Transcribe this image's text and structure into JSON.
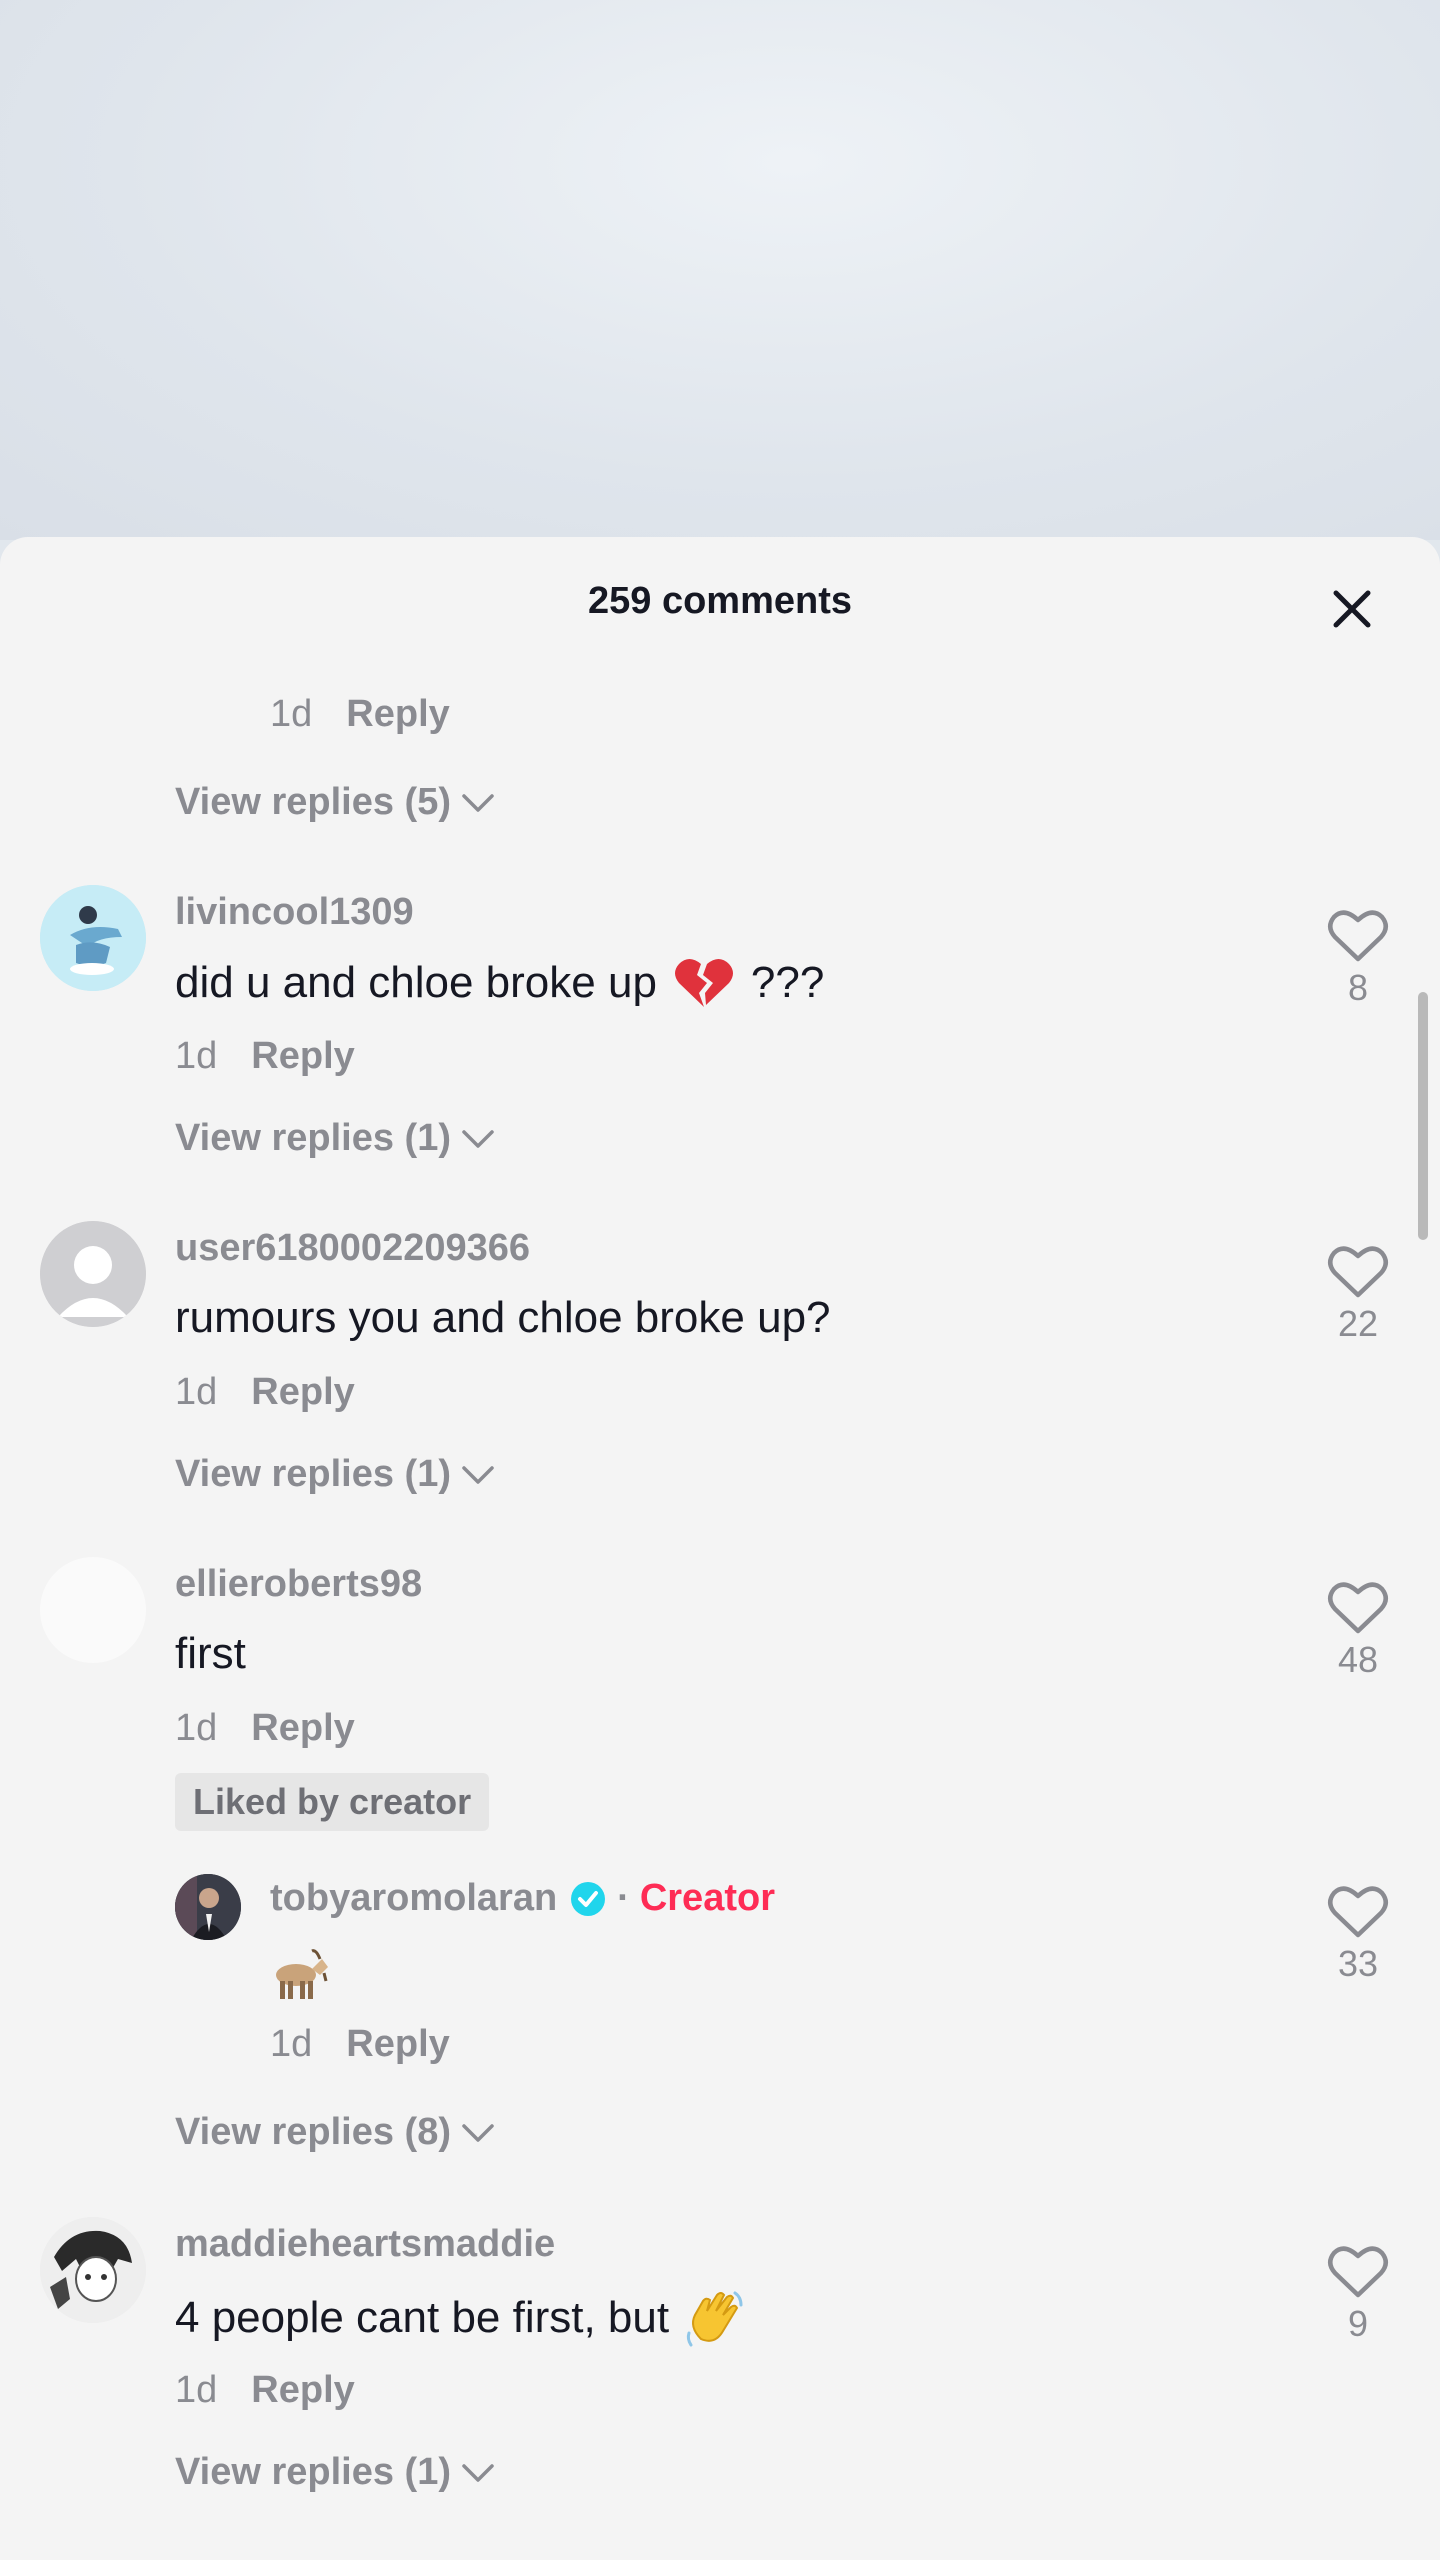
{
  "header": {
    "title": "259 comments"
  },
  "top_partial": {
    "time": "1d",
    "reply_label": "Reply",
    "view_replies": "View replies (5)"
  },
  "comments": [
    {
      "username": "livincool1309",
      "text": "did u and chloe broke up",
      "text_suffix": "???",
      "emoji": "broken-heart",
      "time": "1d",
      "reply_label": "Reply",
      "likes": "8",
      "view_replies": "View replies (1)"
    },
    {
      "username": "user6180002209366",
      "text": "rumours you and chloe broke up?",
      "time": "1d",
      "reply_label": "Reply",
      "likes": "22",
      "view_replies": "View replies (1)"
    },
    {
      "username": "ellieroberts98",
      "text": "first",
      "time": "1d",
      "reply_label": "Reply",
      "likes": "48",
      "badge": "Liked by creator",
      "reply": {
        "username": "tobyaromolaran",
        "separator": "·",
        "creator_label": "Creator",
        "emoji": "goat",
        "time": "1d",
        "reply_label": "Reply",
        "likes": "33"
      },
      "view_replies": "View replies (8)"
    },
    {
      "username": "maddieheartsmaddie",
      "text": "4 people cant be first, but",
      "emoji": "waving-hand",
      "time": "1d",
      "reply_label": "Reply",
      "likes": "9",
      "view_replies": "View replies (1)"
    }
  ],
  "colors": {
    "sheet_bg": "#f4f4f4",
    "primary_text": "#161823",
    "secondary_text": "#8a8b91",
    "creator_accent": "#fe2c55",
    "verified_badge": "#20d5ec"
  }
}
